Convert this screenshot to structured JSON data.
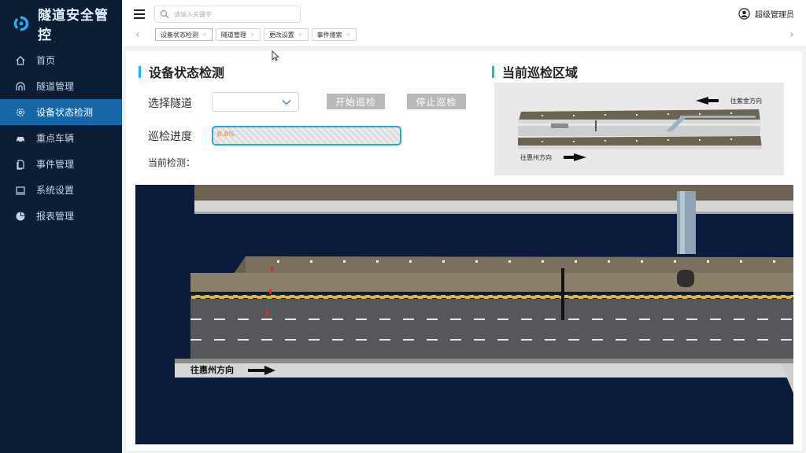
{
  "brand": {
    "title": "隧道安全管控"
  },
  "sidebar": {
    "items": [
      {
        "label": "首页",
        "icon": "home-icon",
        "active": false
      },
      {
        "label": "隧道管理",
        "icon": "tunnel-icon",
        "active": false
      },
      {
        "label": "设备状态检测",
        "icon": "gear-icon",
        "active": true
      },
      {
        "label": "重点车辆",
        "icon": "car-icon",
        "active": false
      },
      {
        "label": "事件管理",
        "icon": "document-icon",
        "active": false
      },
      {
        "label": "系统设置",
        "icon": "monitor-icon",
        "active": false
      },
      {
        "label": "报表管理",
        "icon": "pie-chart-icon",
        "active": false
      }
    ]
  },
  "header": {
    "search": {
      "placeholder": "请输入关键字",
      "value": ""
    },
    "user": {
      "name": "超级管理员"
    },
    "tabs": [
      {
        "label": "设备状态检测",
        "active": true
      },
      {
        "label": "隧道管理",
        "active": false
      },
      {
        "label": "更改设置",
        "active": false
      },
      {
        "label": "事件搜索",
        "active": false
      }
    ],
    "tab_prev": "‹",
    "tab_next": "›"
  },
  "device_panel": {
    "title": "设备状态检测",
    "select_label": "选择隧道",
    "select_value": "",
    "start_button": "开始巡检",
    "stop_button": "停止巡检",
    "progress_label": "巡检进度",
    "progress_value": "0.0%",
    "progress_fraction": 0.0,
    "current_label": "当前检测："
  },
  "patrol_panel": {
    "title": "当前巡检区域",
    "direction_top": "往紫金方向",
    "direction_bottom": "往惠州方向"
  },
  "view3d": {
    "direction_label": "往惠州方向"
  },
  "colors": {
    "sidebar_bg": "#0b1e34",
    "sidebar_active": "#1766a8",
    "accent": "#17b8e6",
    "view_bg": "#0b1b3c"
  }
}
